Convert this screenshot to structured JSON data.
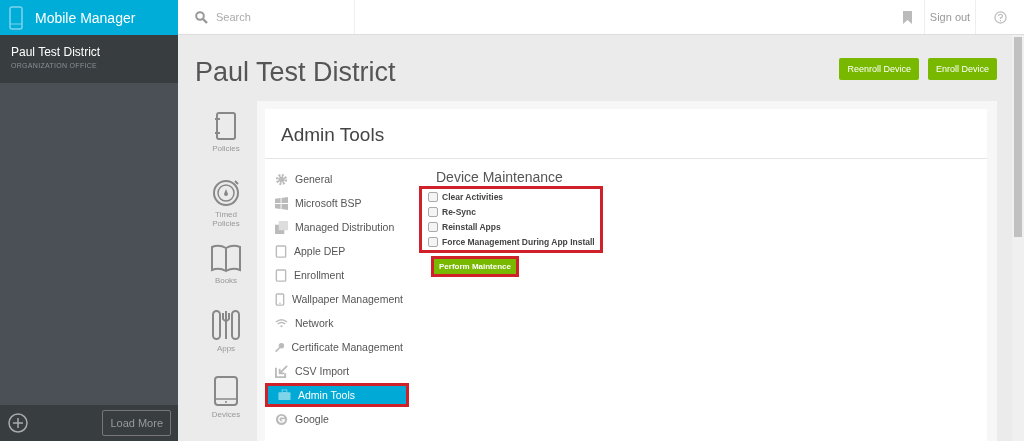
{
  "app": {
    "title": "Mobile Manager"
  },
  "search": {
    "placeholder": "Search"
  },
  "header": {
    "sign_out": "Sign out"
  },
  "organization": {
    "name": "Paul Test District",
    "subtitle": "ORGANIZATION OFFICE"
  },
  "sidebar_footer": {
    "load_more": "Load More"
  },
  "page": {
    "title": "Paul Test District",
    "buttons": [
      "Reenroll Device",
      "Enroll Device"
    ]
  },
  "nav": [
    {
      "label": "Policies",
      "kind": "notebook"
    },
    {
      "label": "Timed Policies",
      "kind": "timer"
    },
    {
      "label": "Books",
      "kind": "book"
    },
    {
      "label": "Apps",
      "kind": "apps"
    },
    {
      "label": "Devices",
      "kind": "tablet"
    }
  ],
  "panel": {
    "title": "Admin Tools"
  },
  "menu": [
    {
      "label": "General",
      "kind": "gear",
      "selected": false
    },
    {
      "label": "Microsoft BSP",
      "kind": "windows",
      "selected": false
    },
    {
      "label": "Managed Distribution",
      "kind": "stack",
      "selected": false
    },
    {
      "label": "Apple DEP",
      "kind": "device",
      "selected": false
    },
    {
      "label": "Enrollment",
      "kind": "device",
      "selected": false
    },
    {
      "label": "Wallpaper Management",
      "kind": "phone",
      "selected": false
    },
    {
      "label": "Network",
      "kind": "wifi",
      "selected": false
    },
    {
      "label": "Certificate Management",
      "kind": "key",
      "selected": false
    },
    {
      "label": "CSV Import",
      "kind": "import",
      "selected": false
    },
    {
      "label": "Admin Tools",
      "kind": "briefcase",
      "selected": true
    },
    {
      "label": "Google",
      "kind": "google",
      "selected": false
    }
  ],
  "maintenance": {
    "title": "Device Maintenance",
    "options": [
      {
        "label": "Clear Activities",
        "checked": false
      },
      {
        "label": "Re-Sync",
        "checked": false
      },
      {
        "label": "Reinstall Apps",
        "checked": false
      },
      {
        "label": "Force Management During App Install",
        "checked": false
      }
    ],
    "button": "Perform Maintence"
  }
}
